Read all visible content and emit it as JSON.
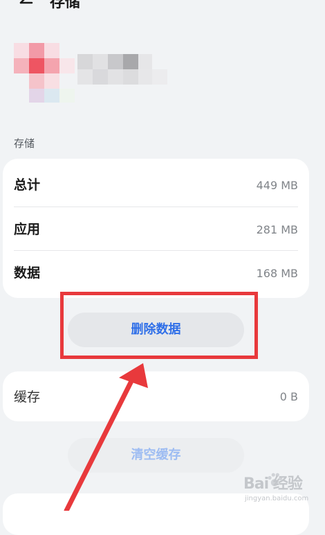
{
  "header": {
    "title": "存储",
    "back_icon": "arrow-left-icon"
  },
  "app": {
    "icon": "blurred-app-icon",
    "name_state": "blurred"
  },
  "storage": {
    "section_label": "存储",
    "rows": [
      {
        "label": "总计",
        "value": "449 MB"
      },
      {
        "label": "应用",
        "value": "281 MB"
      },
      {
        "label": "数据",
        "value": "168 MB"
      }
    ],
    "delete_button": "删除数据"
  },
  "cache": {
    "label": "缓存",
    "value": "0 B",
    "clear_button": "清空缓存"
  },
  "annotation": {
    "frame_color": "#e8393c",
    "arrow_color": "#e8393c"
  },
  "watermark": {
    "main": "Bai 经验",
    "sub": "jingyan.baidu.com"
  },
  "colors": {
    "background": "#f1f3f5",
    "card": "#ffffff",
    "accent": "#2f6fe8",
    "accent_disabled": "#9dbcf2"
  }
}
